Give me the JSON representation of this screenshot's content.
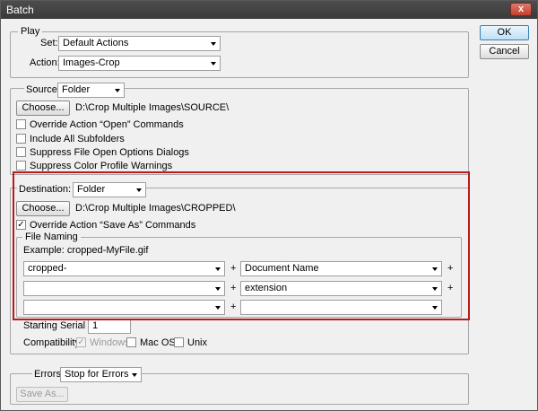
{
  "window": {
    "title": "Batch",
    "close_glyph": "x"
  },
  "buttons": {
    "ok": "OK",
    "cancel": "Cancel"
  },
  "play": {
    "legend": "Play",
    "set_label": "Set:",
    "set_value": "Default Actions",
    "action_label": "Action:",
    "action_value": "Images-Crop"
  },
  "source": {
    "label": "Source:",
    "value": "Folder",
    "choose_label": "Choose...",
    "path": "D:\\Crop Multiple Images\\SOURCE\\",
    "options": [
      {
        "label": "Override Action “Open” Commands",
        "checked": false
      },
      {
        "label": "Include All Subfolders",
        "checked": false
      },
      {
        "label": "Suppress File Open Options Dialogs",
        "checked": false
      },
      {
        "label": "Suppress Color Profile Warnings",
        "checked": false
      }
    ]
  },
  "destination": {
    "label": "Destination:",
    "value": "Folder",
    "choose_label": "Choose...",
    "path": "D:\\Crop Multiple Images\\CROPPED\\",
    "override_label": "Override Action “Save As” Commands",
    "override_checked": true,
    "check_glyph": "✓"
  },
  "file_naming": {
    "legend": "File Naming",
    "example": "Example: cropped-MyFile.gif",
    "plus": "+",
    "rows": [
      {
        "left": "cropped-",
        "right": "Document Name"
      },
      {
        "left": "",
        "right": "extension"
      },
      {
        "left": "",
        "right": ""
      }
    ],
    "serial_label": "Starting Serial #:",
    "serial_value": "1",
    "compat_label": "Compatibility:",
    "compat_windows": "Windows",
    "compat_mac": "Mac OS",
    "compat_unix": "Unix"
  },
  "errors": {
    "label": "Errors:",
    "value": "Stop for Errors",
    "save_as_label": "Save As..."
  },
  "colors": {
    "highlight": "#b81c1c",
    "titlebar": "#3f3f3f"
  }
}
